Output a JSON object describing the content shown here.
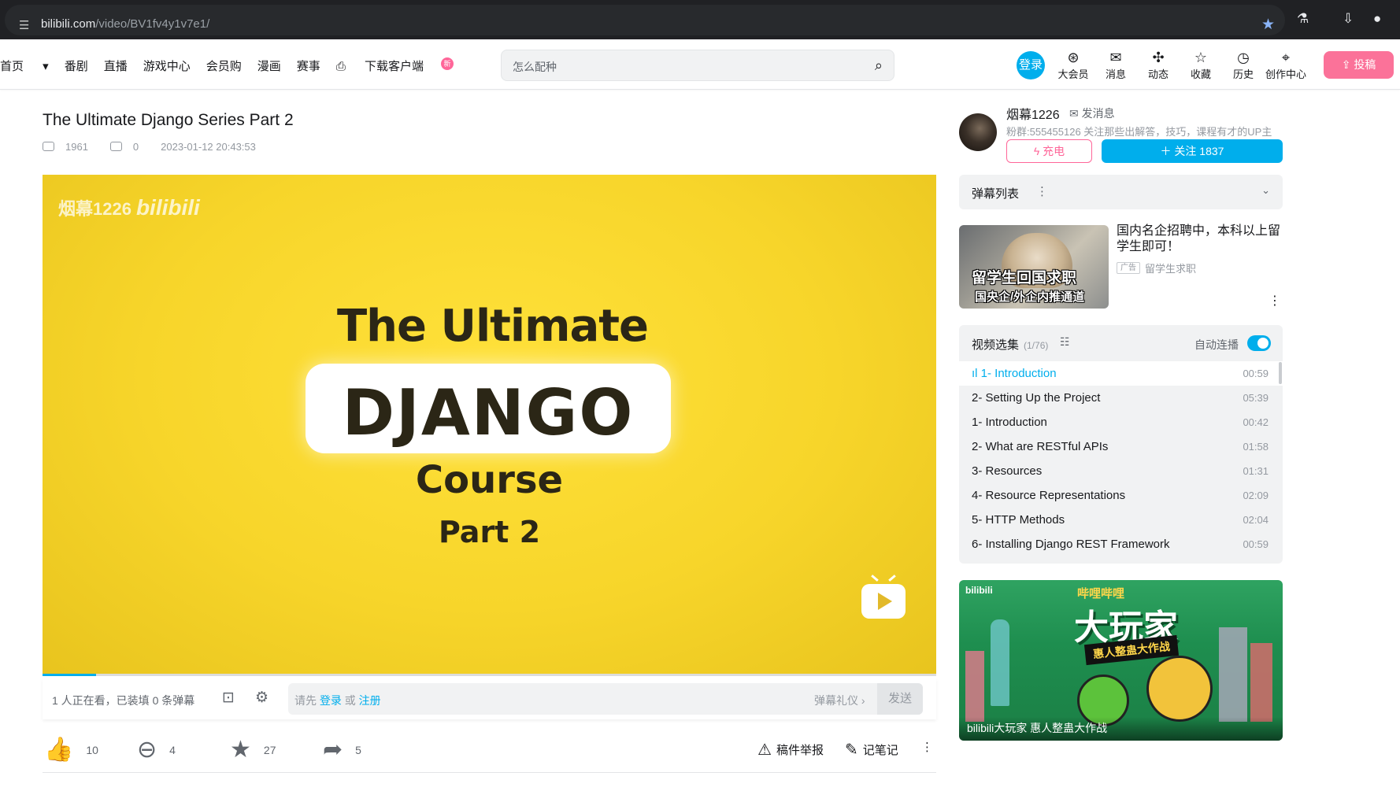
{
  "browser": {
    "url_domain": "bilibili.com",
    "url_path": "/video/BV1fv4y1v7e1/"
  },
  "header": {
    "nav": [
      {
        "label": "首页"
      },
      {
        "label": "番剧"
      },
      {
        "label": "直播"
      },
      {
        "label": "游戏中心"
      },
      {
        "label": "会员购"
      },
      {
        "label": "漫画"
      },
      {
        "label": "赛事"
      },
      {
        "label": "下载客户端"
      }
    ],
    "new_badge": "新",
    "search_placeholder": "怎么配种",
    "login_label": "登录",
    "items": [
      {
        "label": "大会员",
        "icon": "vip-icon"
      },
      {
        "label": "消息",
        "icon": "message-icon"
      },
      {
        "label": "动态",
        "icon": "dynamic-icon"
      },
      {
        "label": "收藏",
        "icon": "favorites-icon"
      },
      {
        "label": "历史",
        "icon": "history-icon"
      },
      {
        "label": "创作中心",
        "icon": "creator-icon"
      }
    ],
    "upload_label": "投稿",
    "brand_color": "#00aeec",
    "pink_color": "#fb7299"
  },
  "video": {
    "title": "The Ultimate Django Series Part 2",
    "views": "1961",
    "danmaku_count": "0",
    "date": "2023-01-12 20:43:53",
    "watermark_name": "烟幕1226",
    "watermark_logo": "bilibili",
    "frame_line1": "The Ultimate",
    "frame_line2": "DJANGO",
    "frame_line3": "Course",
    "frame_line4": "Part 2",
    "progress_fraction": 0.06
  },
  "danmaku_bar": {
    "status": "1 人正在看，已装填 0 条弹幕",
    "placeholder_prefix": "请先",
    "login_link": "登录",
    "or": "或",
    "register_link": "注册",
    "etiquette": "弹幕礼仪 ›",
    "send_label": "发送"
  },
  "toolbar": {
    "like": "10",
    "coin": "4",
    "favorite": "27",
    "share": "5",
    "report_label": "稿件举报",
    "note_label": "记笔记"
  },
  "uploader": {
    "name": "烟幕1226",
    "message_label": "发消息",
    "desc": "粉群:555455126 关注那些出解答，技巧，课程有才的UP主",
    "charge_label": "充电",
    "follow_label": "关注 1837"
  },
  "danmaku_list": {
    "title": "弹幕列表"
  },
  "ad": {
    "image_line1": "留学生回国求职",
    "image_line2": "国央企/外企内推通道",
    "title": "国内名企招聘中，本科以上留学生即可！",
    "badge": "广告",
    "tag": "留学生求职"
  },
  "playlist": {
    "title": "视频选集",
    "count": "(1/76)",
    "autoplay_label": "自动连播",
    "items": [
      {
        "title": "1- Introduction",
        "duration": "00:59"
      },
      {
        "title": "2- Setting Up the Project",
        "duration": "05:39"
      },
      {
        "title": "1- Introduction",
        "duration": "00:42"
      },
      {
        "title": "2- What are RESTful APIs",
        "duration": "01:58"
      },
      {
        "title": "3- Resources",
        "duration": "01:31"
      },
      {
        "title": "4- Resource Representations",
        "duration": "02:09"
      },
      {
        "title": "5- HTTP Methods",
        "duration": "02:04"
      },
      {
        "title": "6- Installing Django REST Framework",
        "duration": "00:59"
      }
    ]
  },
  "banner": {
    "top_text": "哔哩哔哩",
    "title": "大玩家",
    "subtitle": "惠人整蛊大作战",
    "caption": "bilibili大玩家 惠人整蛊大作战"
  }
}
